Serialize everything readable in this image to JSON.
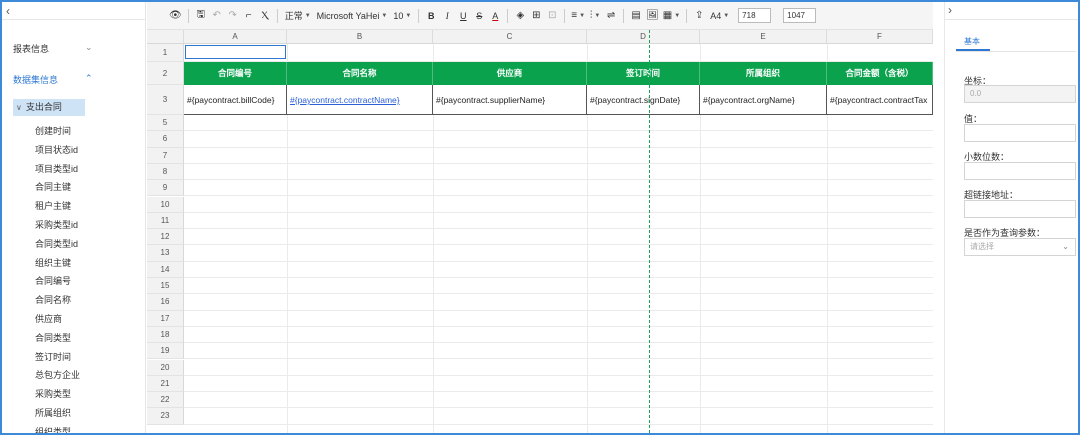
{
  "left_panel": {
    "collapse_icon": "chevron-left-icon",
    "sections": [
      {
        "label": "报表信息",
        "color": "#333333"
      },
      {
        "label": "数据集信息",
        "color": "#2e78d2"
      }
    ],
    "tree_root": "支出合同",
    "fields": [
      "创建时间",
      "项目状态id",
      "项目类型id",
      "合同主键",
      "租户主键",
      "采购类型id",
      "合同类型id",
      "组织主键",
      "合同编号",
      "合同名称",
      "供应商",
      "合同类型",
      "签订时间",
      "总包方企业",
      "采购类型",
      "所属组织",
      "组织类型"
    ]
  },
  "toolbar": {
    "items": [
      {
        "name": "preview-icon",
        "glyph": "👁"
      },
      {
        "sep": true
      },
      {
        "name": "save-icon",
        "glyph": "🖫"
      },
      {
        "name": "undo-icon",
        "glyph": "↶",
        "grey": true
      },
      {
        "name": "redo-icon",
        "glyph": "↷",
        "grey": true
      },
      {
        "name": "format-painter-icon",
        "glyph": "⌐"
      },
      {
        "name": "clear-format-icon",
        "glyph": "Ⲭ"
      },
      {
        "sep": true
      },
      {
        "name": "style-select",
        "text": "正常",
        "dropdown": true
      },
      {
        "name": "font-select",
        "text": "Microsoft YaHei",
        "dropdown": true
      },
      {
        "name": "font-size-select",
        "text": "10",
        "dropdown": true
      },
      {
        "sep": true
      },
      {
        "name": "bold-button",
        "text": "B",
        "style": "font-weight:bold"
      },
      {
        "name": "italic-button",
        "text": "I",
        "style": "font-style:italic;font-family:'Liberation Serif',serif"
      },
      {
        "name": "underline-button",
        "text": "U",
        "style": "text-decoration:underline"
      },
      {
        "name": "strikethrough-button",
        "text": "S",
        "style": "text-decoration:line-through"
      },
      {
        "name": "font-color-button",
        "text": "A",
        "style": "text-decoration:underline;text-decoration-color:#c00"
      },
      {
        "sep": true
      },
      {
        "name": "fill-color-icon",
        "glyph": "◈"
      },
      {
        "name": "border-icon",
        "glyph": "⊞"
      },
      {
        "name": "merge-cells-icon",
        "glyph": "⊡",
        "grey": true
      },
      {
        "sep": true
      },
      {
        "name": "align-horizontal-icon",
        "glyph": "≡",
        "dropdown": true
      },
      {
        "name": "align-vertical-icon",
        "glyph": "⫶",
        "dropdown": true
      },
      {
        "name": "wrap-text-icon",
        "glyph": "⇌"
      },
      {
        "sep": true
      },
      {
        "name": "insert-table-icon",
        "glyph": "▤"
      },
      {
        "name": "insert-image-icon",
        "glyph": "🖼"
      },
      {
        "name": "insert-chart-icon",
        "glyph": "▦",
        "dropdown": true
      },
      {
        "sep": true
      },
      {
        "name": "upload-icon",
        "glyph": "⇪"
      },
      {
        "name": "paper-size-select",
        "text": "A4",
        "dropdown": true
      }
    ],
    "width_value": "718",
    "height_value": "1047"
  },
  "sheet": {
    "columns": [
      "A",
      "B",
      "C",
      "D",
      "E",
      "F"
    ],
    "row_numbers": [
      "1",
      "2",
      "3",
      "4",
      "5",
      "6",
      "7",
      "8",
      "9",
      "10",
      "11",
      "12",
      "13",
      "14",
      "15",
      "16",
      "17",
      "18",
      "19",
      "20",
      "21",
      "22",
      "23"
    ],
    "header_row": [
      "合同编号",
      "合同名称",
      "供应商",
      "签订时间",
      "所属组织",
      "合同金额（含税）"
    ],
    "data_row": [
      "#{paycontract.billCode}",
      "#{paycontract.contractName}",
      "#{paycontract.supplierName}",
      "#{paycontract.signDate}",
      "#{paycontract.orgName}",
      "#{paycontract.contractTax"
    ],
    "header_color": "#0aa24d",
    "link_color": "#2a5fd8"
  },
  "right_panel": {
    "expand_icon": "chevron-right-icon",
    "tab": "基本",
    "coord_label": "坐标：",
    "coord_value": "0.0",
    "value_label": "值：",
    "value_value": "",
    "decimals_label": "小数位数：",
    "decimals_value": "",
    "link_label": "超链接地址：",
    "link_value": "",
    "query_label": "是否作为查询参数：",
    "query_placeholder": "请选择"
  }
}
